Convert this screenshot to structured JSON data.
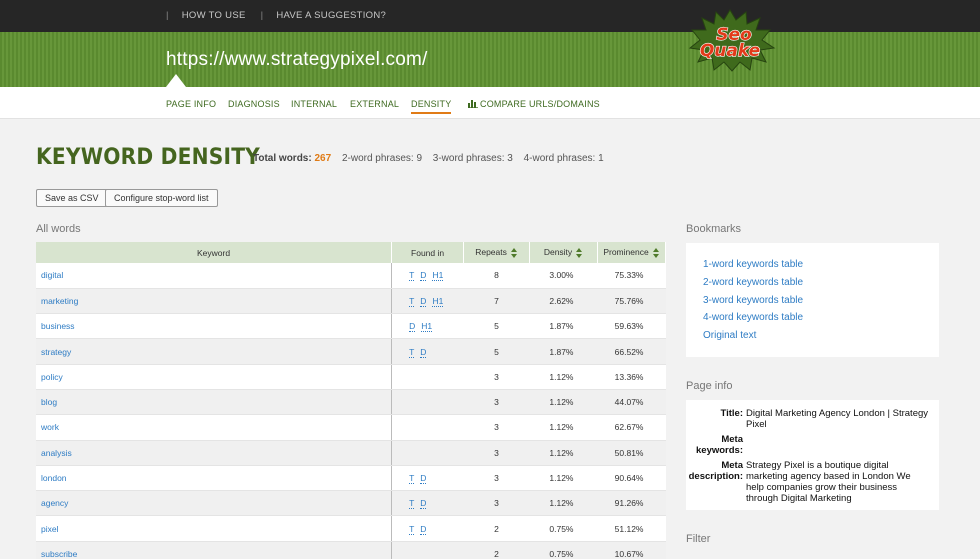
{
  "topbar": {
    "links": [
      "HOW TO USE",
      "HAVE A SUGGESTION?"
    ]
  },
  "header": {
    "url": "https://www.strategypixel.com/",
    "logo_line1": "Seo",
    "logo_line2": "Quake"
  },
  "nav": {
    "tabs": [
      "PAGE INFO",
      "DIAGNOSIS",
      "INTERNAL",
      "EXTERNAL",
      "DENSITY",
      "COMPARE URLS/DOMAINS"
    ],
    "active": "DENSITY"
  },
  "page_title": "KEYWORD DENSITY",
  "stats": {
    "total_label": "Total words:",
    "total": "267",
    "two": "2-word phrases:",
    "two_val": "9",
    "three": "3-word phrases:",
    "three_val": "3",
    "four": "4-word phrases:",
    "four_val": "1"
  },
  "buttons": {
    "csv": "Save as CSV",
    "stopword": "Configure stop-word list"
  },
  "all_words_label": "All words",
  "table": {
    "headers": [
      "Keyword",
      "Found in",
      "Repeats",
      "Density",
      "Prominence"
    ],
    "rows": [
      {
        "keyword": "digital",
        "found": [
          "T",
          "D",
          "H1"
        ],
        "repeats": "8",
        "density": "3.00%",
        "prominence": "75.33%"
      },
      {
        "keyword": "marketing",
        "found": [
          "T",
          "D",
          "H1"
        ],
        "repeats": "7",
        "density": "2.62%",
        "prominence": "75.76%"
      },
      {
        "keyword": "business",
        "found": [
          "D",
          "H1"
        ],
        "repeats": "5",
        "density": "1.87%",
        "prominence": "59.63%"
      },
      {
        "keyword": "strategy",
        "found": [
          "T",
          "D"
        ],
        "repeats": "5",
        "density": "1.87%",
        "prominence": "66.52%"
      },
      {
        "keyword": "policy",
        "found": [],
        "repeats": "3",
        "density": "1.12%",
        "prominence": "13.36%"
      },
      {
        "keyword": "blog",
        "found": [],
        "repeats": "3",
        "density": "1.12%",
        "prominence": "44.07%"
      },
      {
        "keyword": "work",
        "found": [],
        "repeats": "3",
        "density": "1.12%",
        "prominence": "62.67%"
      },
      {
        "keyword": "analysis",
        "found": [],
        "repeats": "3",
        "density": "1.12%",
        "prominence": "50.81%"
      },
      {
        "keyword": "london",
        "found": [
          "T",
          "D"
        ],
        "repeats": "3",
        "density": "1.12%",
        "prominence": "90.64%"
      },
      {
        "keyword": "agency",
        "found": [
          "T",
          "D"
        ],
        "repeats": "3",
        "density": "1.12%",
        "prominence": "91.26%"
      },
      {
        "keyword": "pixel",
        "found": [
          "T",
          "D"
        ],
        "repeats": "2",
        "density": "0.75%",
        "prominence": "51.12%"
      },
      {
        "keyword": "subscribe",
        "found": [],
        "repeats": "2",
        "density": "0.75%",
        "prominence": "10.67%"
      }
    ]
  },
  "bookmarks": {
    "label": "Bookmarks",
    "items": [
      "1-word keywords table",
      "2-word keywords table",
      "3-word keywords table",
      "4-word keywords table",
      "Original text"
    ]
  },
  "page_info": {
    "label": "Page info",
    "rows": [
      {
        "key": "Title:",
        "value": "Digital Marketing Agency London | Strategy Pixel"
      },
      {
        "key": "Meta keywords:",
        "value": ""
      },
      {
        "key": "Meta description:",
        "value": "Strategy Pixel is a boutique digital marketing agency based in London We help companies grow their business through Digital Marketing"
      }
    ]
  },
  "filter_label": "Filter",
  "colors": {
    "green": "#5a8a2f",
    "accent": "#e07b16",
    "link": "#2e7cc4"
  }
}
